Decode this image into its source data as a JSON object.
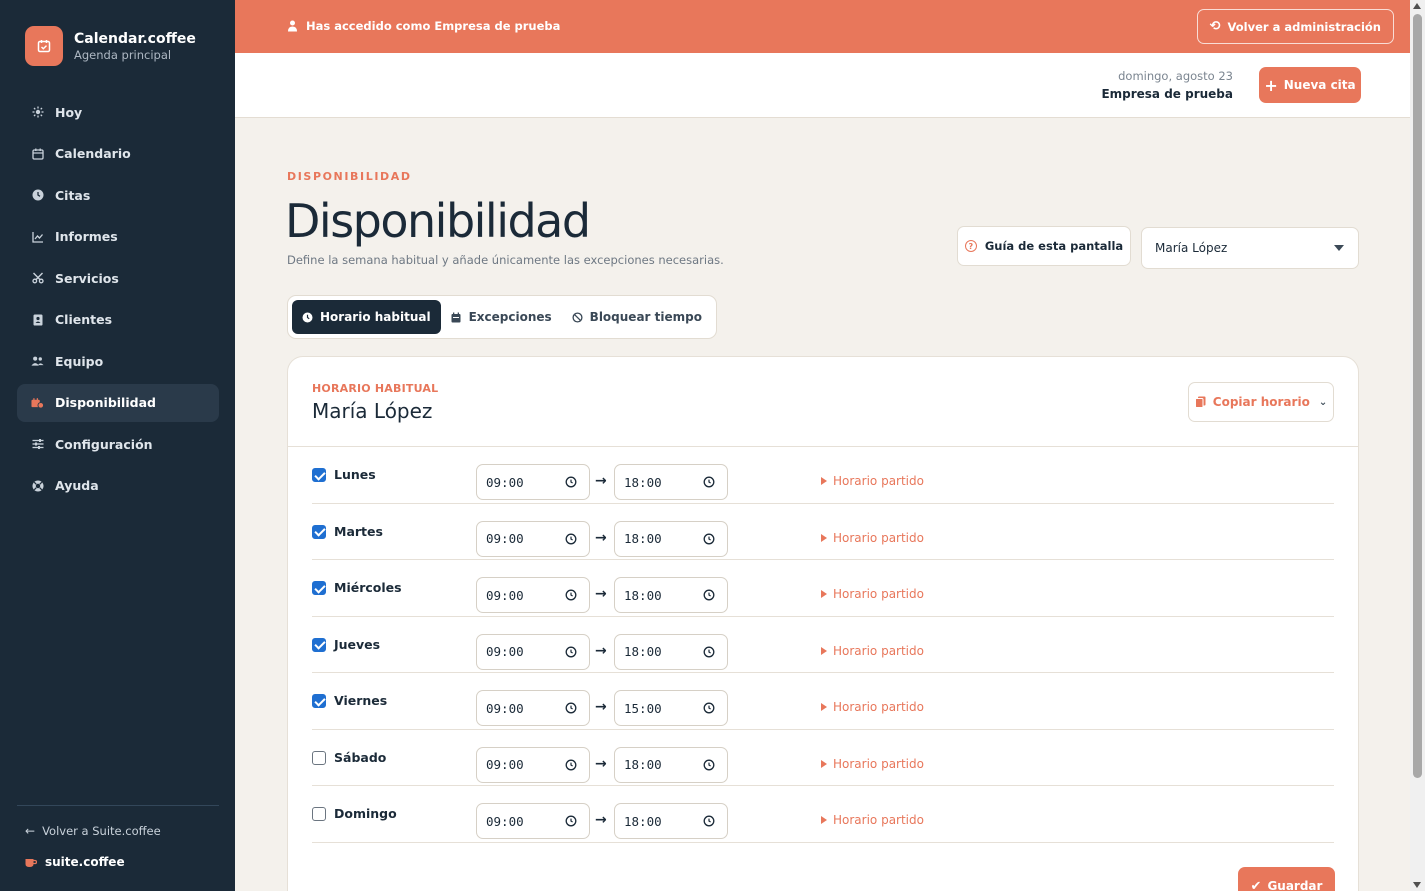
{
  "brand": {
    "name": "Calendar.coffee",
    "subtitle": "Agenda principal",
    "logo_icon": "calendar-check-icon"
  },
  "sidebar": {
    "items": [
      {
        "label": "Hoy",
        "icon": "sun-icon",
        "active": false
      },
      {
        "label": "Calendario",
        "icon": "calendar-icon",
        "active": false
      },
      {
        "label": "Citas",
        "icon": "clock-icon",
        "active": false
      },
      {
        "label": "Informes",
        "icon": "chart-icon",
        "active": false
      },
      {
        "label": "Servicios",
        "icon": "scissors-icon",
        "active": false
      },
      {
        "label": "Clientes",
        "icon": "contact-book-icon",
        "active": false
      },
      {
        "label": "Equipo",
        "icon": "team-icon",
        "active": false
      },
      {
        "label": "Disponibilidad",
        "icon": "availability-icon",
        "active": true
      },
      {
        "label": "Configuración",
        "icon": "sliders-icon",
        "active": false
      },
      {
        "label": "Ayuda",
        "icon": "help-lifebuoy-icon",
        "active": false
      }
    ],
    "back_link": "Volver a Suite.coffee",
    "suite_label": "suite.coffee"
  },
  "banner": {
    "text": "Has accedido como Empresa de prueba",
    "button": "Volver a administración"
  },
  "header": {
    "date": "domingo, agosto 23",
    "company": "Empresa de prueba",
    "new_button": "Nueva cita"
  },
  "page": {
    "eyebrow": "DISPONIBILIDAD",
    "title": "Disponibilidad",
    "description": "Define la semana habitual y añade únicamente las excepciones necesarias.",
    "guide_button": "Guía de esta pantalla",
    "selected_member": "María López"
  },
  "tabs": [
    {
      "label": "Horario habitual",
      "active": true
    },
    {
      "label": "Excepciones",
      "active": false
    },
    {
      "label": "Bloquear tiempo",
      "active": false
    }
  ],
  "card": {
    "eyebrow": "HORARIO HABITUAL",
    "title": "María López",
    "copy_button": "Copiar horario",
    "split_label": "Horario partido",
    "save_button": "Guardar",
    "days": [
      {
        "name": "Lunes",
        "enabled": true,
        "start": "09:00",
        "end": "18:00"
      },
      {
        "name": "Martes",
        "enabled": true,
        "start": "09:00",
        "end": "18:00"
      },
      {
        "name": "Miércoles",
        "enabled": true,
        "start": "09:00",
        "end": "18:00"
      },
      {
        "name": "Jueves",
        "enabled": true,
        "start": "09:00",
        "end": "18:00"
      },
      {
        "name": "Viernes",
        "enabled": true,
        "start": "09:00",
        "end": "15:00"
      },
      {
        "name": "Sábado",
        "enabled": false,
        "start": "09:00",
        "end": "18:00"
      },
      {
        "name": "Domingo",
        "enabled": false,
        "start": "09:00",
        "end": "18:00"
      }
    ]
  },
  "colors": {
    "accent": "#e8775b",
    "sidebar": "#1b2a38",
    "background": "#f4f1ec",
    "checkbox": "#1f6fd1"
  }
}
